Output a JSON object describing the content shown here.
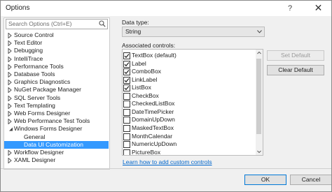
{
  "window": {
    "title": "Options",
    "help_glyph": "?",
    "close_glyph": "✕"
  },
  "search": {
    "placeholder": "Search Options (Ctrl+E)"
  },
  "tree": {
    "items": [
      {
        "label": "Source Control"
      },
      {
        "label": "Text Editor"
      },
      {
        "label": "Debugging"
      },
      {
        "label": "IntelliTrace"
      },
      {
        "label": "Performance Tools"
      },
      {
        "label": "Database Tools"
      },
      {
        "label": "Graphics Diagnostics"
      },
      {
        "label": "NuGet Package Manager"
      },
      {
        "label": "SQL Server Tools"
      },
      {
        "label": "Text Templating"
      },
      {
        "label": "Web Forms Designer"
      },
      {
        "label": "Web Performance Test Tools"
      },
      {
        "label": "Windows Forms Designer"
      },
      {
        "label": "General"
      },
      {
        "label": "Data UI Customization"
      },
      {
        "label": "Workflow Designer"
      },
      {
        "label": "XAML Designer"
      }
    ]
  },
  "data_type": {
    "label": "Data type:",
    "value": "String"
  },
  "associated": {
    "label": "Associated controls:",
    "items": [
      {
        "label": "TextBox (default)",
        "checked": true
      },
      {
        "label": "Label",
        "checked": true
      },
      {
        "label": "ComboBox",
        "checked": true
      },
      {
        "label": "LinkLabel",
        "checked": true
      },
      {
        "label": "ListBox",
        "checked": true
      },
      {
        "label": "CheckBox",
        "checked": false
      },
      {
        "label": "CheckedListBox",
        "checked": false
      },
      {
        "label": "DateTimePicker",
        "checked": false
      },
      {
        "label": "DomainUpDown",
        "checked": false
      },
      {
        "label": "MaskedTextBox",
        "checked": false
      },
      {
        "label": "MonthCalendar",
        "checked": false
      },
      {
        "label": "NumericUpDown",
        "checked": false
      },
      {
        "label": "PictureBox",
        "checked": false
      }
    ]
  },
  "buttons": {
    "set_default": "Set Default",
    "clear_default": "Clear Default",
    "ok": "OK",
    "cancel": "Cancel"
  },
  "link": {
    "text": "Learn how to add custom controls"
  },
  "colors": {
    "selection": "#3399ff",
    "link": "#0066cc",
    "ok_border": "#0078d7"
  }
}
